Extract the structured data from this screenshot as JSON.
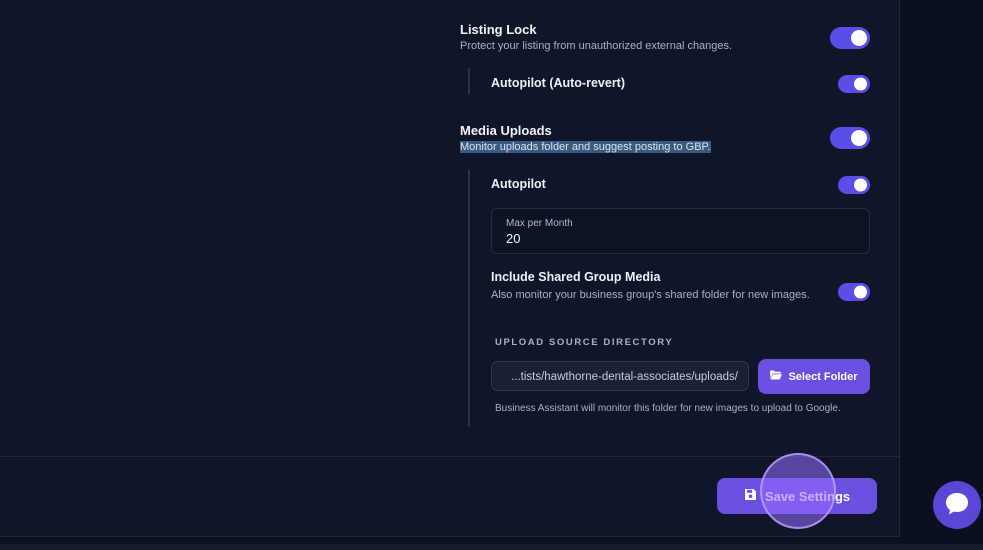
{
  "listing_lock": {
    "title": "Listing Lock",
    "description": "Protect your listing from unauthorized external changes.",
    "enabled": true,
    "autopilot": {
      "label": "Autopilot (Auto-revert)",
      "enabled": true
    }
  },
  "media_uploads": {
    "title": "Media Uploads",
    "description": "Monitor uploads folder and suggest posting to GBP.",
    "enabled": true,
    "autopilot": {
      "label": "Autopilot",
      "enabled": true
    },
    "max_per_month": {
      "label": "Max per Month",
      "value": "20"
    },
    "shared_group": {
      "title": "Include Shared Group Media",
      "description": "Also monitor your business group's shared folder for new images.",
      "enabled": true
    },
    "upload_source": {
      "label": "UPLOAD SOURCE DIRECTORY",
      "path": "...tists/hawthorne-dental-associates/uploads/",
      "select_button": "Select Folder",
      "helper": "Business Assistant will monitor this folder for new images to upload to Google."
    }
  },
  "footer": {
    "save_button": "Save Settings"
  },
  "icons": {
    "folder": "folder-open-icon",
    "save": "floppy-disk-icon",
    "chat": "chat-bubble-icon"
  },
  "colors": {
    "accent": "#5b4ee6",
    "button": "#6a4fe0",
    "background": "#0f1629"
  }
}
